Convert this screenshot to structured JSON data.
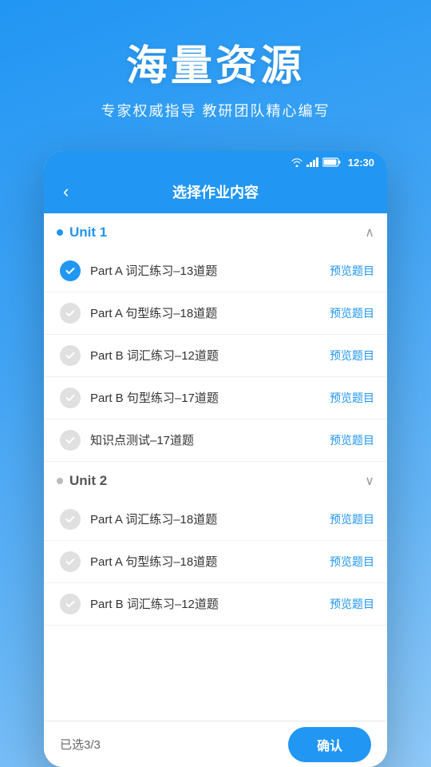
{
  "hero": {
    "title": "海量资源",
    "subtitle": "专家权威指导 教研团队精心编写"
  },
  "statusBar": {
    "time": "12:30"
  },
  "navBar": {
    "backLabel": "‹",
    "title": "选择作业内容"
  },
  "unit1": {
    "label": "Unit 1",
    "expanded": true,
    "chevron": "∧",
    "lessons": [
      {
        "text": "Part A 词汇练习–13道题",
        "checked": true,
        "preview": "预览题目"
      },
      {
        "text": "Part A 句型练习–18道题",
        "checked": false,
        "preview": "预览题目"
      },
      {
        "text": "Part B 词汇练习–12道题",
        "checked": false,
        "preview": "预览题目"
      },
      {
        "text": "Part B 句型练习–17道题",
        "checked": false,
        "preview": "预览题目"
      },
      {
        "text": "知识点测试–17道题",
        "checked": false,
        "preview": "预览题目"
      }
    ]
  },
  "unit2": {
    "label": "Unit 2",
    "expanded": false,
    "chevron": "∨",
    "lessons": [
      {
        "text": "Part A 词汇练习–18道题",
        "checked": false,
        "preview": "预览题目"
      },
      {
        "text": "Part A 句型练习–18道题",
        "checked": false,
        "preview": "预览题目"
      },
      {
        "text": "Part B 词汇练习–12道题",
        "checked": false,
        "preview": "预览题目"
      }
    ]
  },
  "bottomBar": {
    "selected": "已选3/3",
    "confirmLabel": "确认"
  },
  "colors": {
    "primary": "#2196f3",
    "checked": "#2196f3",
    "unchecked": "#e0e0e0",
    "previewLink": "#2196f3"
  }
}
